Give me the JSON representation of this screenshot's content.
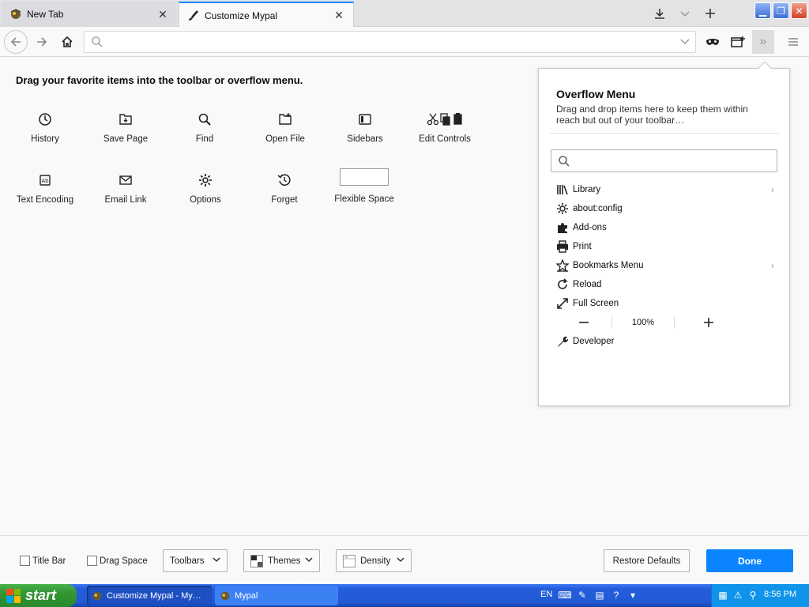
{
  "tabs": [
    {
      "label": "New Tab",
      "active": false
    },
    {
      "label": "Customize Mypal",
      "active": true
    }
  ],
  "customize": {
    "title": "Drag your favorite items into the toolbar or overflow menu.",
    "items": [
      {
        "label": "History",
        "icon": "clock-icon"
      },
      {
        "label": "Save Page",
        "icon": "save-page-icon"
      },
      {
        "label": "Find",
        "icon": "magnifier-icon"
      },
      {
        "label": "Open File",
        "icon": "open-file-icon"
      },
      {
        "label": "Sidebars",
        "icon": "sidebar-icon"
      },
      {
        "label": "Edit Controls",
        "icon": "edit-controls-icon"
      },
      {
        "label": "Text Encoding",
        "icon": "text-encoding-icon"
      },
      {
        "label": "Email Link",
        "icon": "envelope-icon"
      },
      {
        "label": "Options",
        "icon": "gear-icon"
      },
      {
        "label": "Forget",
        "icon": "forget-icon"
      },
      {
        "label": "Flexible Space",
        "icon": "flexible-space"
      }
    ]
  },
  "overflow": {
    "title": "Overflow Menu",
    "description": "Drag and drop items here to keep them within reach but out of your toolbar…",
    "items": [
      {
        "label": "Library",
        "has_submenu": true
      },
      {
        "label": "about:config",
        "has_submenu": false
      },
      {
        "label": "Add-ons",
        "has_submenu": false
      },
      {
        "label": "Print",
        "has_submenu": false
      },
      {
        "label": "Bookmarks Menu",
        "has_submenu": true
      },
      {
        "label": "Reload",
        "has_submenu": false
      },
      {
        "label": "Full Screen",
        "has_submenu": false
      }
    ],
    "zoom": "100%",
    "developer": "Developer"
  },
  "footer": {
    "title_bar": "Title Bar",
    "drag_space": "Drag Space",
    "toolbars": "Toolbars",
    "themes": "Themes",
    "density": "Density",
    "restore": "Restore Defaults",
    "done": "Done"
  },
  "taskbar": {
    "start": "start",
    "tasks": [
      "Customize Mypal - My…",
      "Mypal"
    ],
    "lang": "EN",
    "clock": "8:56 PM"
  },
  "colors": {
    "accent": "#0a84ff",
    "taskbar": "#245ddb"
  }
}
